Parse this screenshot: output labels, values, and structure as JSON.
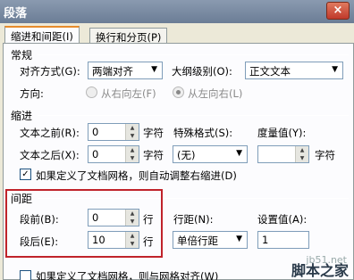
{
  "window": {
    "title": "段落",
    "close": "×"
  },
  "tabs": [
    {
      "label": "缩进和间距(I)",
      "active": true
    },
    {
      "label": "换行和分页(P)",
      "active": false
    }
  ],
  "general": {
    "heading": "常规",
    "align_label": "对齐方式(G):",
    "align_value": "两端对齐",
    "outline_label": "大纲级别(O):",
    "outline_value": "正文文本",
    "direction_label": "方向:",
    "rtl_label": "从右向左(F)",
    "ltr_label": "从左向右(L)"
  },
  "indent": {
    "heading": "缩进",
    "before_label": "文本之前(R):",
    "before_value": "0",
    "before_unit": "字符",
    "after_label": "文本之后(X):",
    "after_value": "0",
    "after_unit": "字符",
    "special_label": "特殊格式(S):",
    "special_value": "(无)",
    "measure_label": "度量值(Y):",
    "measure_unit": "字符",
    "grid_check_label": "如果定义了文档网格，则自动调整右缩进(D)"
  },
  "spacing": {
    "heading": "间距",
    "before_label": "段前(B):",
    "before_value": "0",
    "before_unit": "行",
    "after_label": "段后(E):",
    "after_value": "10",
    "after_unit": "行",
    "line_label": "行距(N):",
    "line_value": "单倍行距",
    "setting_label": "设置值(A):",
    "setting_value": "1",
    "grid_check_label": "如果定义了文档网格，则与网格对齐(W)"
  },
  "watermark": {
    "site": "jb51.net",
    "name": "脚本之家"
  },
  "colors": {
    "highlight": "#c0232a",
    "tab_accent": "#e68b2c"
  }
}
